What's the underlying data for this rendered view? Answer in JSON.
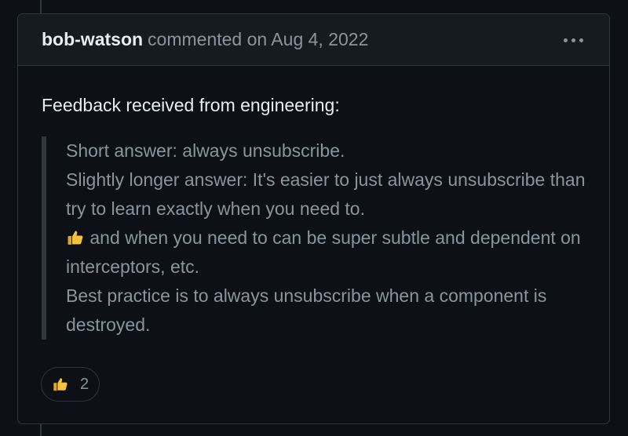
{
  "comment": {
    "author": "bob-watson",
    "meta": "commented on Aug 4, 2022",
    "intro": "Feedback received from engineering:",
    "quote": {
      "line1": "Short answer: always unsubscribe.",
      "line2": "Slightly longer answer: It's easier to just always unsubscribe than try to learn exactly when you need to.",
      "line3_after_emoji": " and when you need to can be super subtle and dependent on interceptors, etc.",
      "line4": "Best practice is to always unsubscribe when a component is destroyed."
    },
    "reaction": {
      "icon": "thumbs-up-icon",
      "count": "2"
    }
  },
  "colors": {
    "background": "#0d1117",
    "header_bg": "#161b22",
    "border": "#30363d",
    "text": "#e6edf3",
    "muted": "#8b949e",
    "emoji": "#f4c23c"
  }
}
